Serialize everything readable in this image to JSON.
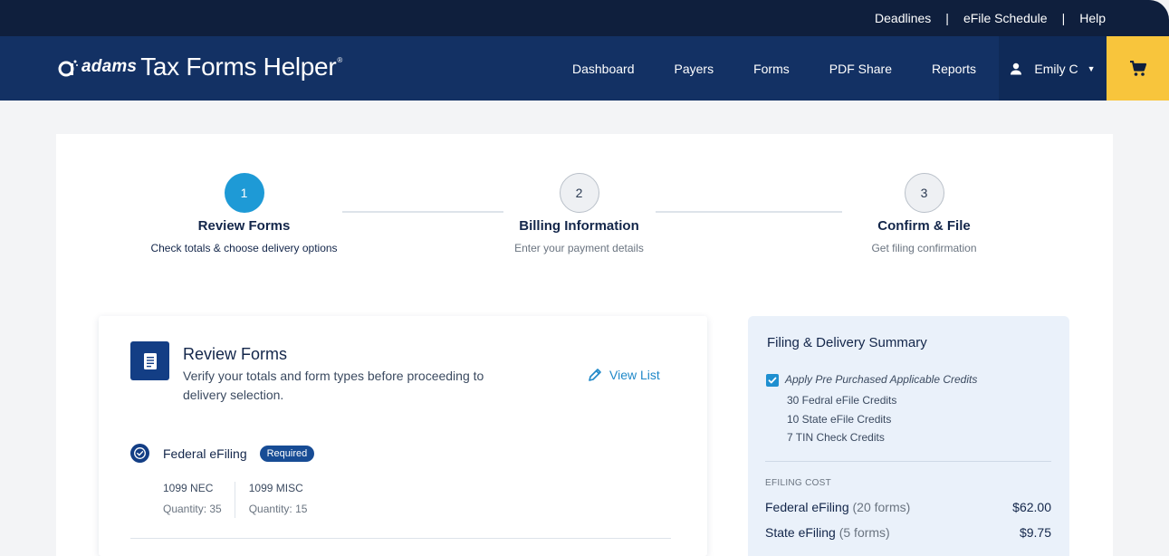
{
  "topbar": {
    "links": [
      "Deadlines",
      "eFile Schedule",
      "Help"
    ]
  },
  "brand": {
    "adams": "adams",
    "product": "Tax Forms Helper",
    "reg": "®"
  },
  "nav": {
    "items": [
      "Dashboard",
      "Payers",
      "Forms",
      "PDF Share",
      "Reports"
    ]
  },
  "user": {
    "name": "Emily C"
  },
  "steps": [
    {
      "number": "1",
      "title": "Review Forms",
      "subtitle": "Check totals & choose delivery options"
    },
    {
      "number": "2",
      "title": "Billing Information",
      "subtitle": "Enter your payment details"
    },
    {
      "number": "3",
      "title": "Confirm & File",
      "subtitle": "Get filing confirmation"
    }
  ],
  "review": {
    "title": "Review Forms",
    "description": "Verify your totals and form types before proceeding to delivery selection.",
    "view_list": "View List",
    "federal": {
      "label": "Federal eFiling",
      "badge": "Required",
      "forms": [
        {
          "name": "1099 NEC",
          "quantity": "Quantity: 35"
        },
        {
          "name": "1099 MISC",
          "quantity": "Quantity: 15"
        }
      ]
    }
  },
  "summary": {
    "title": "Filing & Delivery Summary",
    "apply_label": "Apply Pre Purchased Applicable Credits",
    "credits": [
      "30 Fedral eFile Credits",
      "10 State eFile Credits",
      "7 TIN Check Credits"
    ],
    "cost_heading": "EFILING COST",
    "rows": [
      {
        "label": "Federal eFiling",
        "detail": "(20 forms)",
        "amount": "$62.00"
      },
      {
        "label": "State eFiling",
        "detail": "(5 forms)",
        "amount": "$9.75"
      }
    ]
  },
  "colors": {
    "navy": "#133164",
    "topbar": "#0f1f3d",
    "accent": "#1e9ad6",
    "cart": "#f8c53c"
  }
}
